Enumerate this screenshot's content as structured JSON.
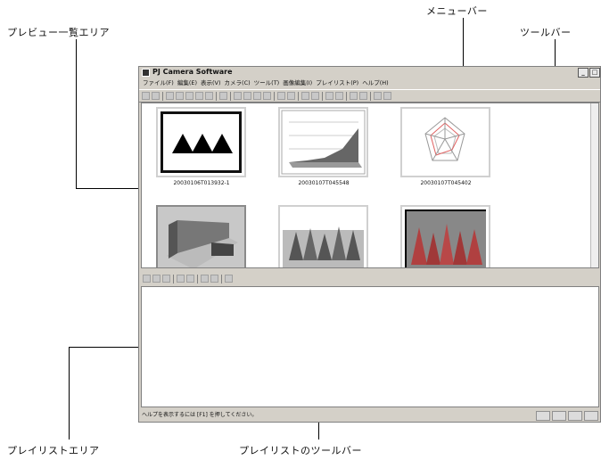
{
  "callouts": {
    "menubar": "メニューバー",
    "toolbar": "ツールバー",
    "preview_area": "プレビュー一覧エリア",
    "playlist_area": "プレイリストエリア",
    "playlist_toolbar": "プレイリストのツールバー"
  },
  "window": {
    "title": "PJ Camera Software",
    "menu": [
      "ファイル(F)",
      "編集(E)",
      "表示(V)",
      "カメラ(C)",
      "ツール(T)",
      "画像編集(I)",
      "プレイリスト(P)",
      "ヘルプ(H)"
    ],
    "thumbnails": [
      {
        "caption": "20030106T013932-1",
        "icon": "triangles-slide"
      },
      {
        "caption": "20030107T045548",
        "icon": "area-chart-slide"
      },
      {
        "caption": "20030107T045402",
        "icon": "radar-chart-slide"
      },
      {
        "caption": "",
        "icon": "3d-bar-chart-slide"
      },
      {
        "caption": "",
        "icon": "cone-chart-slide"
      },
      {
        "caption": "",
        "icon": "cone-chart-slide-2"
      }
    ],
    "status_text": "ヘルプを表示するには [F1] を押してください。"
  }
}
